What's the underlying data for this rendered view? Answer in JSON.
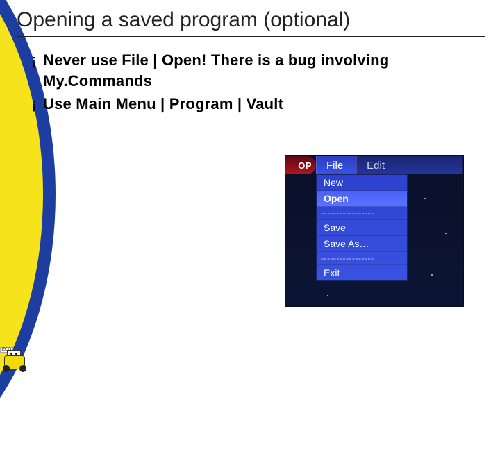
{
  "title": "Opening a saved program (optional)",
  "bullets": [
    "Never use File | Open! There is a bug involving My.Commands",
    "Use Main Menu | Program | Vault"
  ],
  "bullet_marker": "¡",
  "menu": {
    "stop": "OP",
    "file": "File",
    "edit": "Edit",
    "items": {
      "new": "New",
      "open": "Open",
      "sep": "-----------------",
      "save": "Save",
      "saveas": "Save As…",
      "exit": "Exit"
    }
  },
  "robot_tag": "ECO"
}
